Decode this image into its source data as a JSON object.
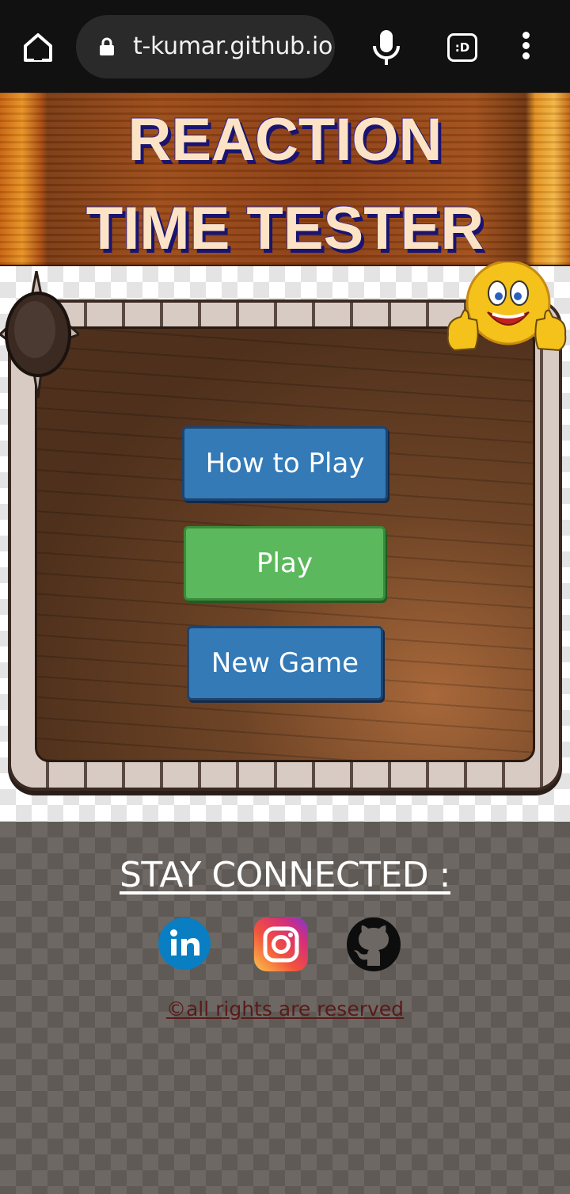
{
  "browser": {
    "url": "t-kumar.github.io",
    "tab_label": ":D",
    "icons": [
      "home-icon",
      "lock-icon",
      "mic-icon",
      "tabs-icon",
      "menu-icon"
    ]
  },
  "header": {
    "title_line1": "REACTION",
    "title_line2": "TIME TESTER"
  },
  "menu": {
    "how_to_play": "How to Play",
    "play": "Play",
    "new_game": "New Game"
  },
  "footer": {
    "stay_connected": "STAY CONNECTED :",
    "social": [
      "linkedin-icon",
      "instagram-icon",
      "github-icon"
    ],
    "rights": "©all rights are reserved"
  },
  "colors": {
    "blue_button": "#337ab7",
    "green_button": "#5cb85c",
    "title_text": "#fde3c6",
    "title_shadow": "#1a1470"
  }
}
